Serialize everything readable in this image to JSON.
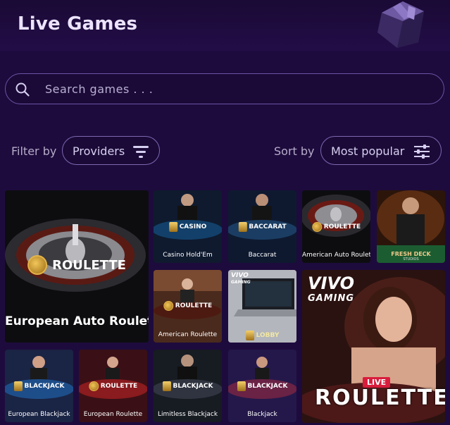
{
  "header": {
    "title": "Live Games",
    "icon": "treasure-chest-icon"
  },
  "search": {
    "placeholder": "Search games . . .",
    "icon": "search-icon"
  },
  "filters": {
    "filter_label": "Filter by",
    "providers_label": "Providers",
    "sort_label": "Sort by",
    "sort_value": "Most popular"
  },
  "games": {
    "european_auto_roulette": {
      "title": "European Auto Roulette",
      "badge": "ROULETTE"
    },
    "casino_holdem": {
      "title": "Casino Hold'Em",
      "badge": "CASINO"
    },
    "baccarat": {
      "title": "Baccarat",
      "badge": "BACCARAT"
    },
    "american_auto_roulette": {
      "title": "American Auto Roulette",
      "badge": "ROULETTE"
    },
    "fresh_deck": {
      "badge": "FRESH DECK",
      "sub": "STUDIOS"
    },
    "american_roulette": {
      "title": "American Roulette",
      "badge": "ROULETTE"
    },
    "vivo_lobby": {
      "brand": "VIVO",
      "brand_sub": "GAMING",
      "badge": "LOBBY"
    },
    "vivo_live_roulette": {
      "brand": "VIVO",
      "brand_sub": "GAMING",
      "live": "LIVE",
      "badge": "ROULETTE"
    },
    "european_blackjack": {
      "title": "European Blackjack",
      "badge": "BLACKJACK"
    },
    "european_roulette": {
      "title": "European Roulette",
      "badge": "ROULETTE"
    },
    "limitless_blackjack": {
      "title": "Limitless Blackjack",
      "badge": "BLACKJACK"
    },
    "blackjack": {
      "title": "Blackjack",
      "badge": "BLACKJACK"
    }
  },
  "colors": {
    "background": "#1e0b3d",
    "accent": "#7b69b2",
    "title": "#ece4ff"
  }
}
